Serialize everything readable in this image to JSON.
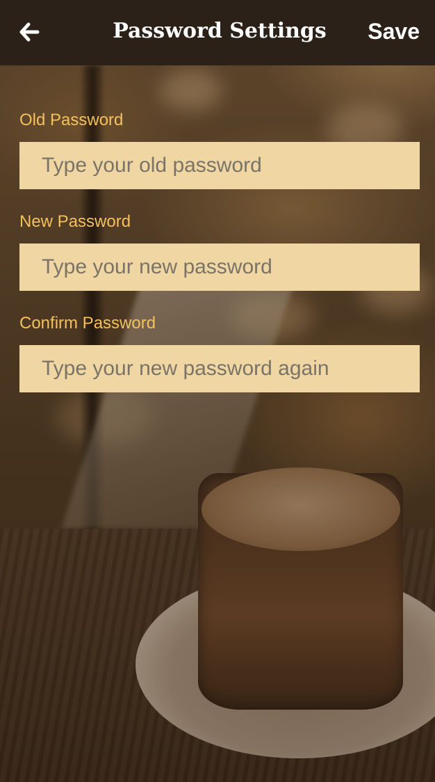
{
  "header": {
    "title": "Password Settings",
    "save_label": "Save",
    "back_icon": "arrow-left-icon"
  },
  "form": {
    "old_password": {
      "label": "Old Password",
      "placeholder": "Type your old password",
      "value": ""
    },
    "new_password": {
      "label": "New Password",
      "placeholder": "Type your new password",
      "value": ""
    },
    "confirm_password": {
      "label": "Confirm Password",
      "placeholder": "Type your new password again",
      "value": ""
    }
  },
  "colors": {
    "header_bg": "#2b2119",
    "label": "#f4c05e",
    "input_bg": "#efd6a2",
    "placeholder": "#7a7468",
    "header_text": "#ffffff"
  }
}
